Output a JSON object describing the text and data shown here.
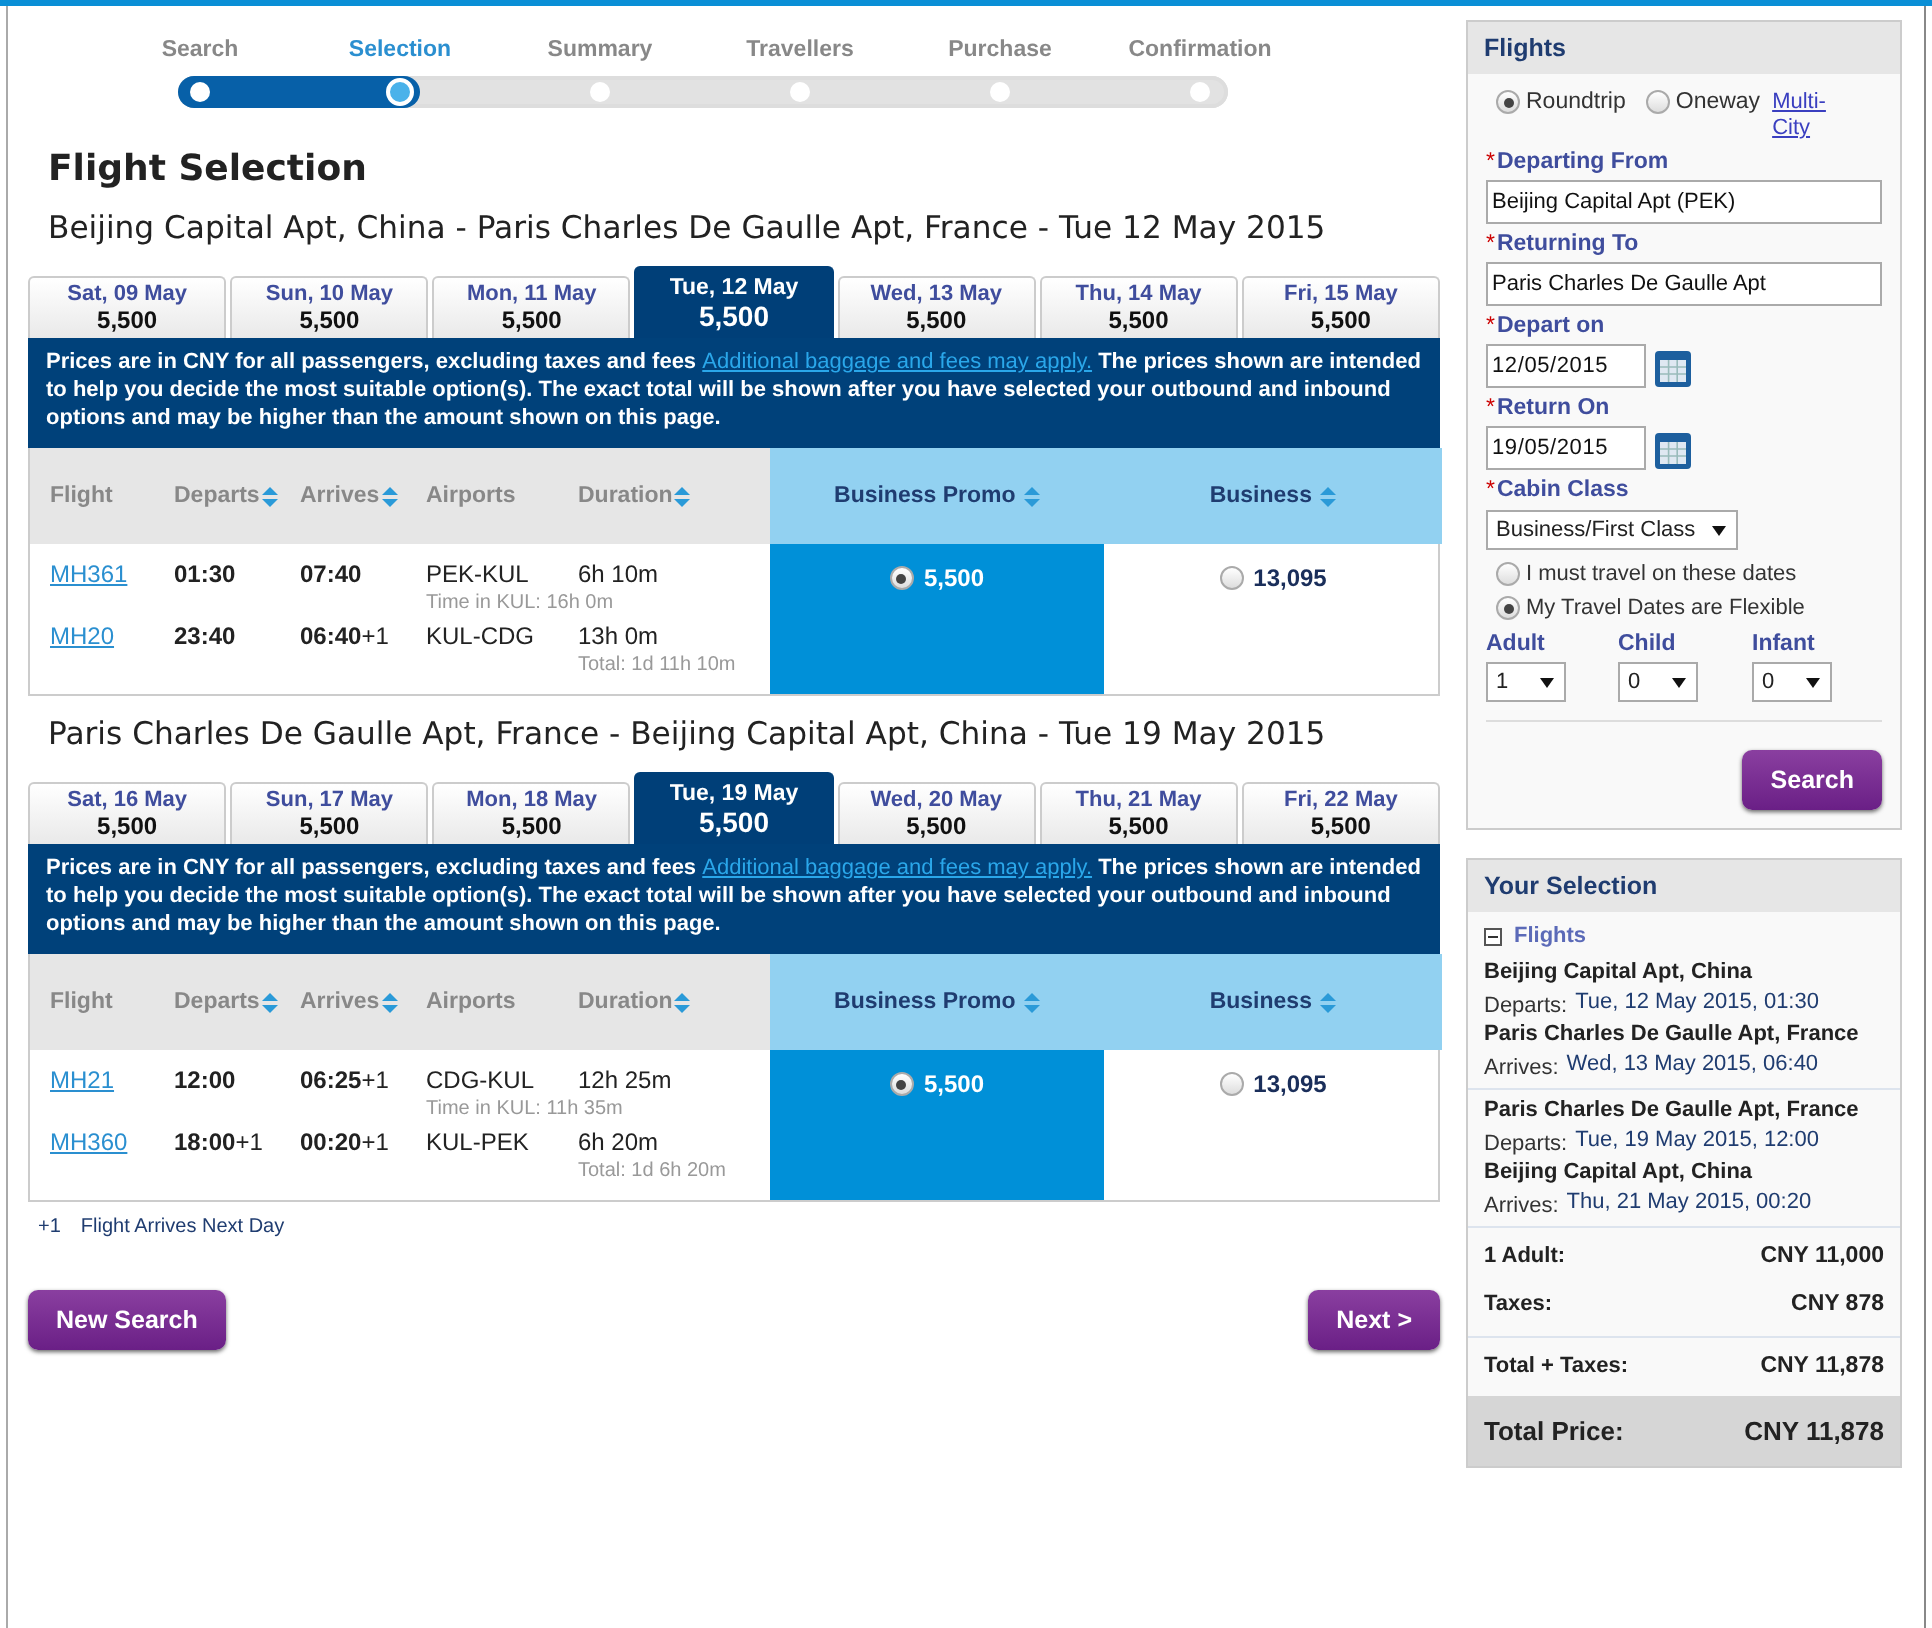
{
  "progress": {
    "steps": [
      {
        "label": "Search",
        "selected": false
      },
      {
        "label": "Selection",
        "selected": true
      },
      {
        "label": "Summary",
        "selected": false
      },
      {
        "label": "Travellers",
        "selected": false
      },
      {
        "label": "Purchase",
        "selected": false
      },
      {
        "label": "Confirmation",
        "selected": false
      }
    ]
  },
  "page_title": "Flight Selection",
  "legs": [
    {
      "title": "Beijing Capital Apt, China - Paris Charles De Gaulle Apt, France - Tue 12 May 2015",
      "dates": [
        {
          "day": "Sat, 09 May",
          "price": "5,500",
          "selected": false
        },
        {
          "day": "Sun, 10 May",
          "price": "5,500",
          "selected": false
        },
        {
          "day": "Mon, 11 May",
          "price": "5,500",
          "selected": false
        },
        {
          "day": "Tue, 12 May",
          "price": "5,500",
          "selected": true
        },
        {
          "day": "Wed, 13 May",
          "price": "5,500",
          "selected": false
        },
        {
          "day": "Thu, 14 May",
          "price": "5,500",
          "selected": false
        },
        {
          "day": "Fri, 15 May",
          "price": "5,500",
          "selected": false
        }
      ],
      "notice": {
        "before": "Prices are in CNY for all passengers, excluding taxes and fees",
        "link": "Additional baggage and fees may apply.",
        "after": "The prices shown are intended to help you decide the most suitable option(s). The exact total will be shown after you have selected your outbound and inbound options and may be higher than the amount shown on this page."
      },
      "columns": [
        {
          "label": "Flight",
          "sortable": false
        },
        {
          "label": "Departs",
          "sortable": true
        },
        {
          "label": "Arrives",
          "sortable": true
        },
        {
          "label": "Airports",
          "sortable": false
        },
        {
          "label": "Duration",
          "sortable": true
        }
      ],
      "segments": [
        {
          "flight": "MH361",
          "departs": "**01:30**",
          "arrives": "**07:40**",
          "airports": "PEK-KUL",
          "duration": "6h 10m",
          "note": {
            "kind": "layover",
            "text": "Time in KUL: 16h 0m"
          }
        },
        {
          "flight": "MH20",
          "departs": "**23:40**",
          "arrives": "**06:40**+1",
          "airports": "KUL-CDG",
          "duration": "13h 0m",
          "note": {
            "kind": "total",
            "text": "Total: 1d 11h 10m"
          }
        }
      ],
      "fares": [
        {
          "label": "Business Promo",
          "price": "5,500",
          "selected": true
        },
        {
          "label": "Business",
          "price": "13,095",
          "selected": false
        }
      ]
    },
    {
      "title": "Paris Charles De Gaulle Apt, France - Beijing Capital Apt, China - Tue 19 May 2015",
      "dates": [
        {
          "day": "Sat, 16 May",
          "price": "5,500",
          "selected": false
        },
        {
          "day": "Sun, 17 May",
          "price": "5,500",
          "selected": false
        },
        {
          "day": "Mon, 18 May",
          "price": "5,500",
          "selected": false
        },
        {
          "day": "Tue, 19 May",
          "price": "5,500",
          "selected": true
        },
        {
          "day": "Wed, 20 May",
          "price": "5,500",
          "selected": false
        },
        {
          "day": "Thu, 21 May",
          "price": "5,500",
          "selected": false
        },
        {
          "day": "Fri, 22 May",
          "price": "5,500",
          "selected": false
        }
      ],
      "notice": {
        "before": "Prices are in CNY for all passengers, excluding taxes and fees",
        "link": "Additional baggage and fees may apply.",
        "after": "The prices shown are intended to help you decide the most suitable option(s). The exact total will be shown after you have selected your outbound and inbound options and may be higher than the amount shown on this page."
      },
      "columns": [
        {
          "label": "Flight",
          "sortable": false
        },
        {
          "label": "Departs",
          "sortable": true
        },
        {
          "label": "Arrives",
          "sortable": true
        },
        {
          "label": "Airports",
          "sortable": false
        },
        {
          "label": "Duration",
          "sortable": true
        }
      ],
      "segments": [
        {
          "flight": "MH21",
          "departs": "**12:00**",
          "arrives": "**06:25**+1",
          "airports": "CDG-KUL",
          "duration": "12h 25m",
          "note": {
            "kind": "layover",
            "text": "Time in KUL: 11h 35m"
          }
        },
        {
          "flight": "MH360",
          "departs": "**18:00**+1",
          "arrives": "**00:20**+1",
          "airports": "KUL-PEK",
          "duration": "6h 20m",
          "note": {
            "kind": "total",
            "text": "Total: 1d 6h 20m"
          }
        }
      ],
      "fares": [
        {
          "label": "Business Promo",
          "price": "5,500",
          "selected": true
        },
        {
          "label": "Business",
          "price": "13,095",
          "selected": false
        }
      ]
    }
  ],
  "legend": {
    "mark": "+1",
    "text": "Flight Arrives Next Day"
  },
  "buttons": {
    "new_search": "New Search",
    "next": "Next >"
  },
  "search_panel": {
    "title": "Flights",
    "trip_types": [
      {
        "label": "Roundtrip",
        "selected": true
      },
      {
        "label": "Oneway",
        "selected": false
      }
    ],
    "multi_city": "Multi-City",
    "fields": [
      {
        "kind": "text",
        "mark": "*",
        "label": "Departing From",
        "value": "Beijing Capital Apt (PEK)"
      },
      {
        "kind": "text",
        "mark": "*",
        "label": "Returning To",
        "value": "Paris Charles De Gaulle Apt"
      },
      {
        "kind": "date",
        "mark": "*",
        "label": "Depart on",
        "value": "12/05/2015"
      },
      {
        "kind": "date",
        "mark": "*",
        "label": "Return On",
        "value": "19/05/2015"
      },
      {
        "kind": "select",
        "mark": "*",
        "label": "Cabin Class",
        "value": "Business/First Class"
      }
    ],
    "flexibility": [
      {
        "label": "I must travel on these dates",
        "selected": false
      },
      {
        "label": "My Travel Dates are Flexible",
        "selected": true
      }
    ],
    "passengers": [
      {
        "label": "Adult",
        "value": "1"
      },
      {
        "label": "Child",
        "value": "0"
      },
      {
        "label": "Infant",
        "value": "0"
      }
    ],
    "search_button": "Search"
  },
  "selection_panel": {
    "title": "Your Selection",
    "section": "Flights",
    "expanded": true,
    "journeys": [
      [
        {
          "place": "Beijing Capital Apt, China",
          "label": "Departs:",
          "value": "Tue, 12 May 2015, 01:30"
        },
        {
          "place": "Paris Charles De Gaulle Apt, France",
          "label": "Arrives:",
          "value": "Wed, 13 May 2015, 06:40"
        }
      ],
      [
        {
          "place": "Paris Charles De Gaulle Apt, France",
          "label": "Departs:",
          "value": "Tue, 19 May 2015, 12:00"
        },
        {
          "place": "Beijing Capital Apt, China",
          "label": "Arrives:",
          "value": "Thu, 21 May 2015, 00:20"
        }
      ]
    ],
    "totals": [
      {
        "kind": "line",
        "label": "1 Adult:",
        "value": "CNY 11,000"
      },
      {
        "kind": "line",
        "label": "Taxes:",
        "value": "CNY 878"
      },
      {
        "kind": "subtotal",
        "label": "Total + Taxes:",
        "value": "CNY 11,878"
      },
      {
        "kind": "grand",
        "label": "Total Price:",
        "value": "CNY 11,878"
      }
    ]
  }
}
